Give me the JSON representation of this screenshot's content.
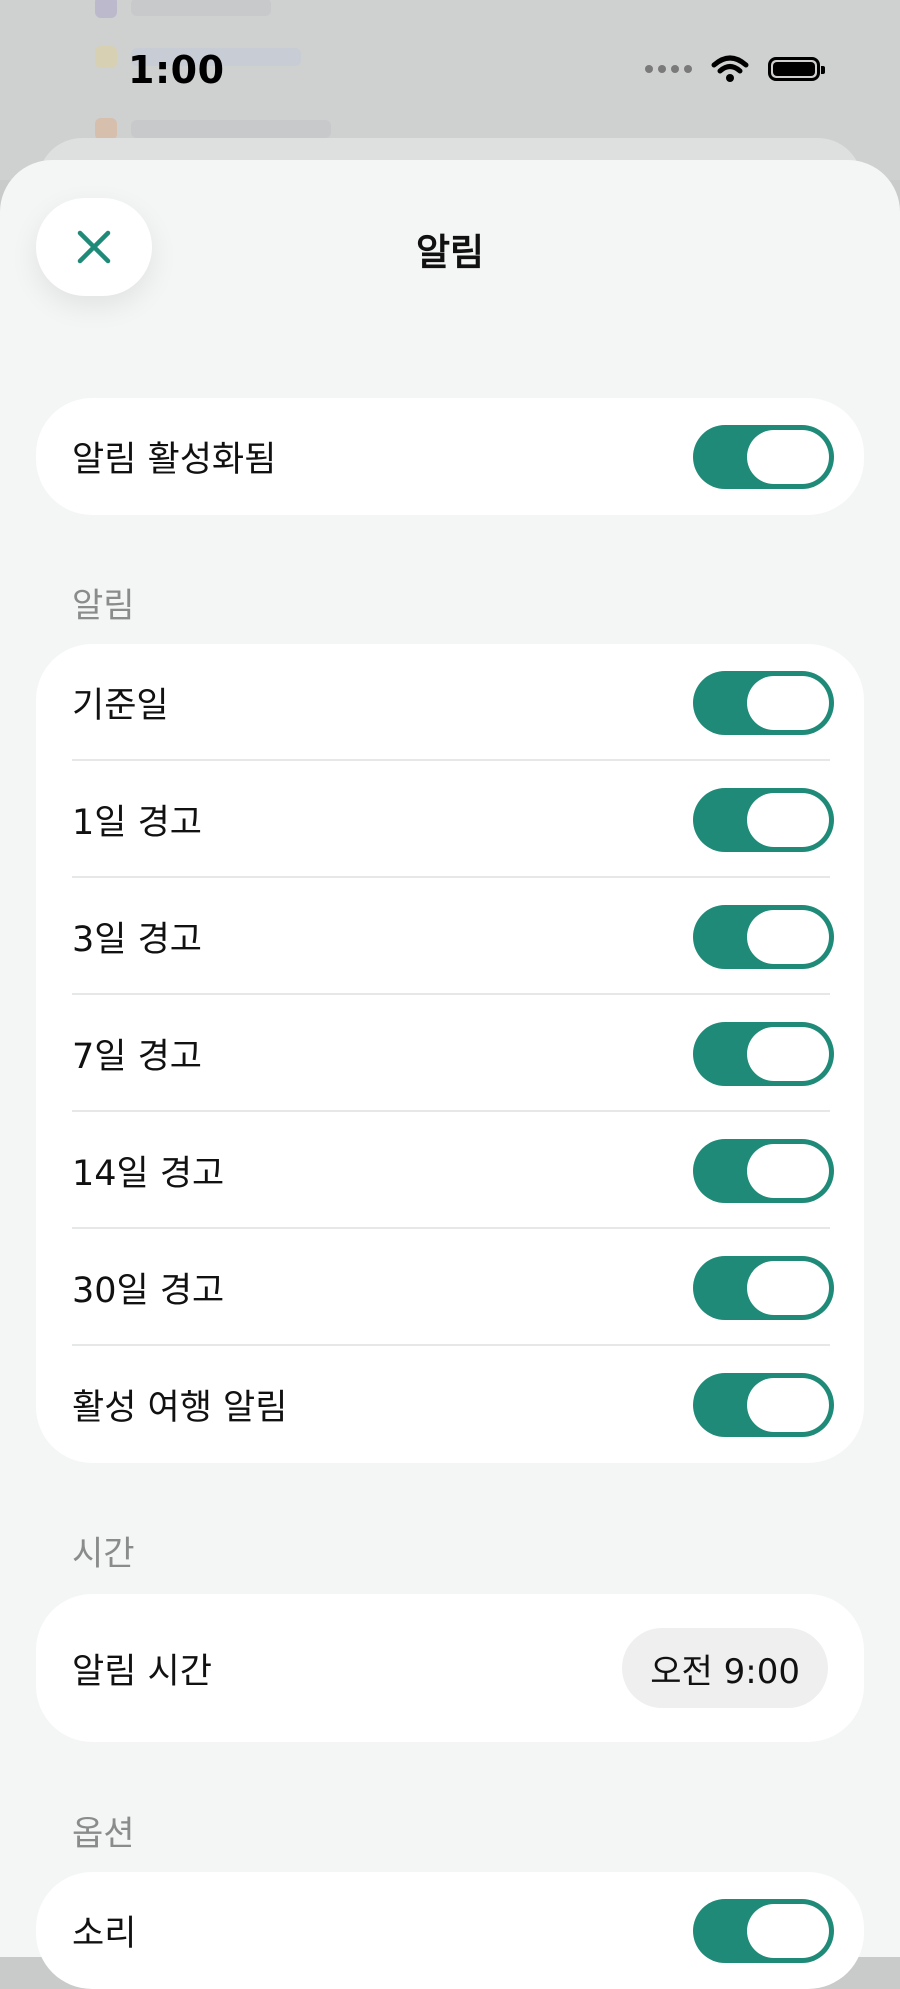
{
  "status_bar": {
    "time": "1:00"
  },
  "sheet": {
    "title": "알림"
  },
  "master": {
    "label": "알림 활성화됨",
    "on": true
  },
  "sections": {
    "alerts_header": "알림",
    "time_header": "시간",
    "options_header": "옵션"
  },
  "alerts": [
    {
      "label": "기준일",
      "on": true
    },
    {
      "label": "1일 경고",
      "on": true
    },
    {
      "label": "3일 경고",
      "on": true
    },
    {
      "label": "7일 경고",
      "on": true
    },
    {
      "label": "14일 경고",
      "on": true
    },
    {
      "label": "30일 경고",
      "on": true
    },
    {
      "label": "활성 여행 알림",
      "on": true
    }
  ],
  "time_setting": {
    "label": "알림 시간",
    "value": "오전 9:00"
  },
  "options": [
    {
      "label": "소리",
      "on": true
    }
  ],
  "colors": {
    "accent": "#1f8a78",
    "background": "#f4f5f5",
    "card": "#ffffff"
  },
  "icons": {
    "close": "close-icon",
    "wifi": "wifi-icon",
    "battery": "battery-icon",
    "signal": "signal-icon"
  }
}
